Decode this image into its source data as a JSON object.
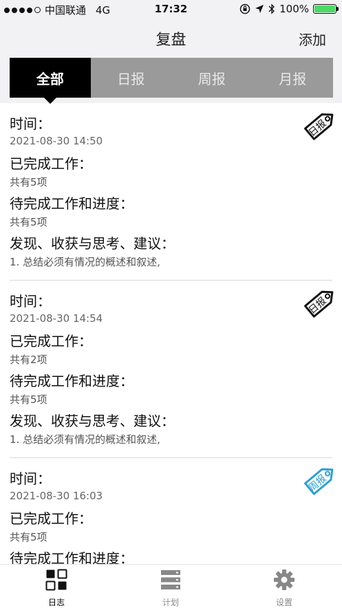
{
  "status": {
    "carrier": "中国联通",
    "network": "4G",
    "time": "17:32",
    "battery": "100%"
  },
  "header": {
    "title": "复盘",
    "add_label": "添加"
  },
  "tabs": [
    {
      "label": "全部",
      "active": true
    },
    {
      "label": "日报",
      "active": false
    },
    {
      "label": "周报",
      "active": false
    },
    {
      "label": "月报",
      "active": false
    }
  ],
  "entries": [
    {
      "tag": "日报",
      "tag_color": "#111111",
      "time_label": "时间：",
      "time_value": "2021-08-30 14:50",
      "done_label": "已完成工作：",
      "done_value": "共有5项",
      "todo_label": "待完成工作和进度：",
      "todo_value": "共有5项",
      "insight_label": "发现、收获与思考、建议：",
      "insight_value": "1.  总结必须有情况的概述和叙述,"
    },
    {
      "tag": "日报",
      "tag_color": "#111111",
      "time_label": "时间：",
      "time_value": "2021-08-30 14:54",
      "done_label": "已完成工作：",
      "done_value": "共有2项",
      "todo_label": "待完成工作和进度：",
      "todo_value": "共有5项",
      "insight_label": "发现、收获与思考、建议：",
      "insight_value": "1.  总结必须有情况的概述和叙述,"
    },
    {
      "tag": "周报",
      "tag_color": "#2a9fd6",
      "time_label": "时间：",
      "time_value": "2021-08-30 16:03",
      "done_label": "已完成工作：",
      "done_value": "共有5项",
      "todo_label": "待完成工作和进度：",
      "todo_value": "",
      "insight_label": "",
      "insight_value": ""
    }
  ],
  "tabbar": [
    {
      "label": "日志",
      "icon": "grid-icon",
      "active": true
    },
    {
      "label": "计划",
      "icon": "list-icon",
      "active": false
    },
    {
      "label": "设置",
      "icon": "gear-icon",
      "active": false
    }
  ]
}
